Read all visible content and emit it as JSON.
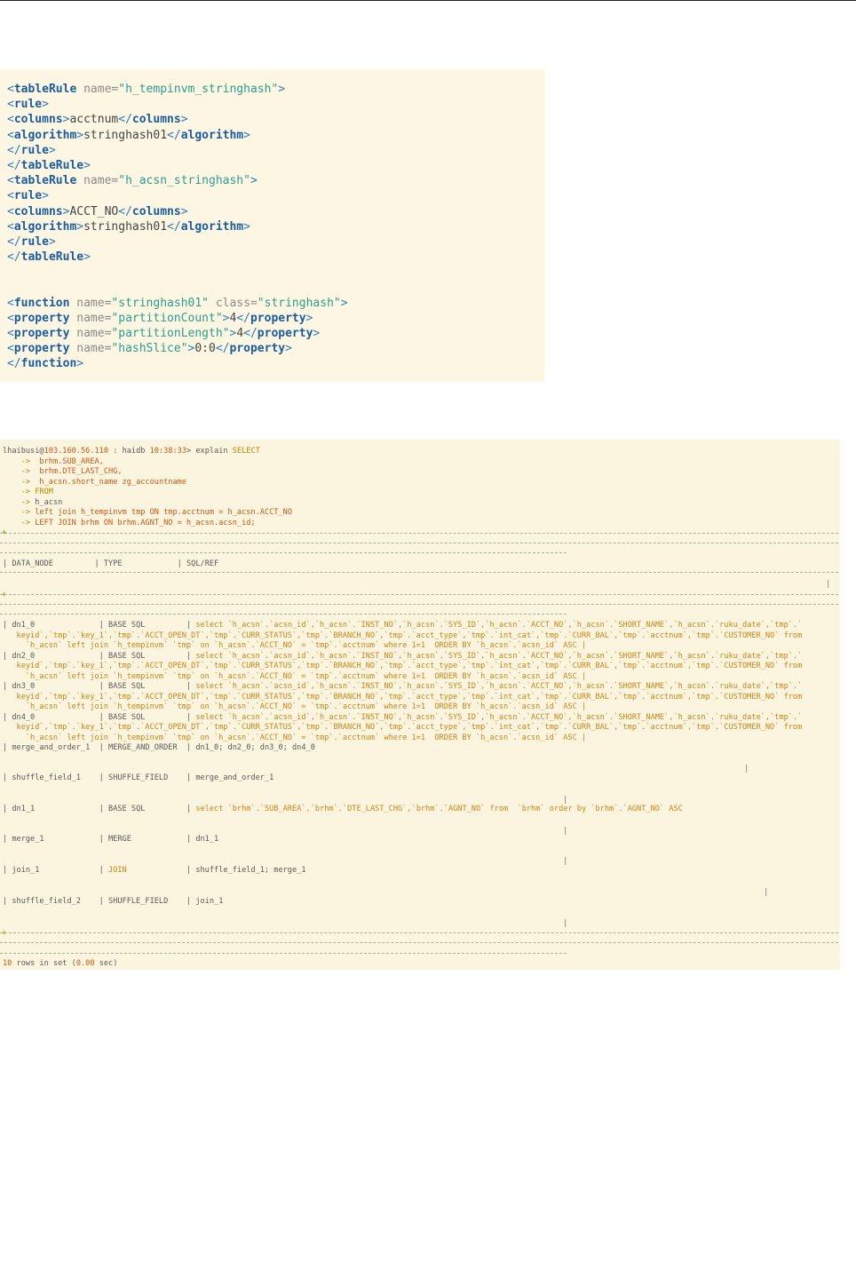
{
  "xml": {
    "rule1_name": "h_tempinvm_stringhash",
    "rule1_columns": "acctnum",
    "rule1_algorithm": "stringhash01",
    "rule2_name": "h_acsn_stringhash",
    "rule2_columns": "ACCT_NO",
    "rule2_algorithm": "stringhash01",
    "function_name": "stringhash01",
    "function_class": "stringhash",
    "prop1_name": "partitionCount",
    "prop1_value": "4",
    "prop2_name": "partitionLength",
    "prop2_value": "4",
    "prop3_name": "hashSlice",
    "prop3_value": "0:0"
  },
  "terminal": {
    "user": "lhaibusi",
    "host": "103.160.56.110",
    "db": "haidb",
    "time": "10:38:33",
    "query_lines": [
      "brhm.SUB_AREA,",
      "brhm.DTE_LAST_CHG,",
      "h_acsn.short_name zg_accountname",
      "FROM",
      "h_acsn",
      "left join h_tempinvm tmp ON tmp.acctnum = h_acsn.ACCT_NO",
      "LEFT JOIN brhm ON brhm.AGNT_NO = h_acsn.acsn_id;"
    ],
    "headers": [
      "DATA_NODE",
      "TYPE",
      "SQL/REF"
    ],
    "base_sql_rows": [
      {
        "node": "dn1_0",
        "type": "BASE SQL"
      },
      {
        "node": "dn2_0",
        "type": "BASE SQL"
      },
      {
        "node": "dn3_0",
        "type": "BASE SQL"
      },
      {
        "node": "dn4_0",
        "type": "BASE SQL"
      }
    ],
    "sql_part1": "select `h_acsn`.`acsn_id`,`h_acsn`.`INST_NO`,`h_acsn`.`SYS_ID`,`h_acsn`.`ACCT_NO`,`h_acsn`.`SHORT_NAME`,`h_acsn`.`ruku_date`,`tmp`.`",
    "sql_part2": "keyid`,`tmp`.`key_1`,`tmp`.`ACCT_OPEN_DT`,`tmp`.`CURR_STATUS`,`tmp`.`BRANCH_NO`,`tmp`.`acct_type`,`tmp`.`int_cat`,`tmp`.`CURR_BAL`,`tmp`.`acctnum`,`tmp`.`CUSTOMER_NO` from",
    "sql_part3": "`h_acsn` left join `h_tempinvm` `tmp` on `h_acsn`.`ACCT_NO` = `tmp`.`acctnum` where 1=1  ORDER BY `h_acsn`.`acsn_id` ASC |",
    "other_rows": [
      {
        "node": "merge_and_order_1",
        "type": "MERGE_AND_ORDER",
        "ref": "dn1_0; dn2_0; dn3_0; dn4_0"
      },
      {
        "node": "shuffle_field_1",
        "type": "SHUFFLE_FIELD",
        "ref": "merge_and_order_1"
      },
      {
        "node": "dn1_1",
        "type": "BASE SQL",
        "ref": "select `brhm`.`SUB_AREA`,`brhm`.`DTE_LAST_CHG`,`brhm`.`AGNT_NO` from  `brhm` order by `brhm`.`AGNT_NO` ASC"
      },
      {
        "node": "merge_1",
        "type": "MERGE",
        "ref": "dn1_1"
      },
      {
        "node": "join_1",
        "type": "JOIN",
        "ref": "shuffle_field_1; merge_1"
      },
      {
        "node": "shuffle_field_2",
        "type": "SHUFFLE_FIELD",
        "ref": "join_1"
      }
    ],
    "footer_count": "10",
    "footer_rest": "rows in set",
    "footer_time": "0.00"
  }
}
